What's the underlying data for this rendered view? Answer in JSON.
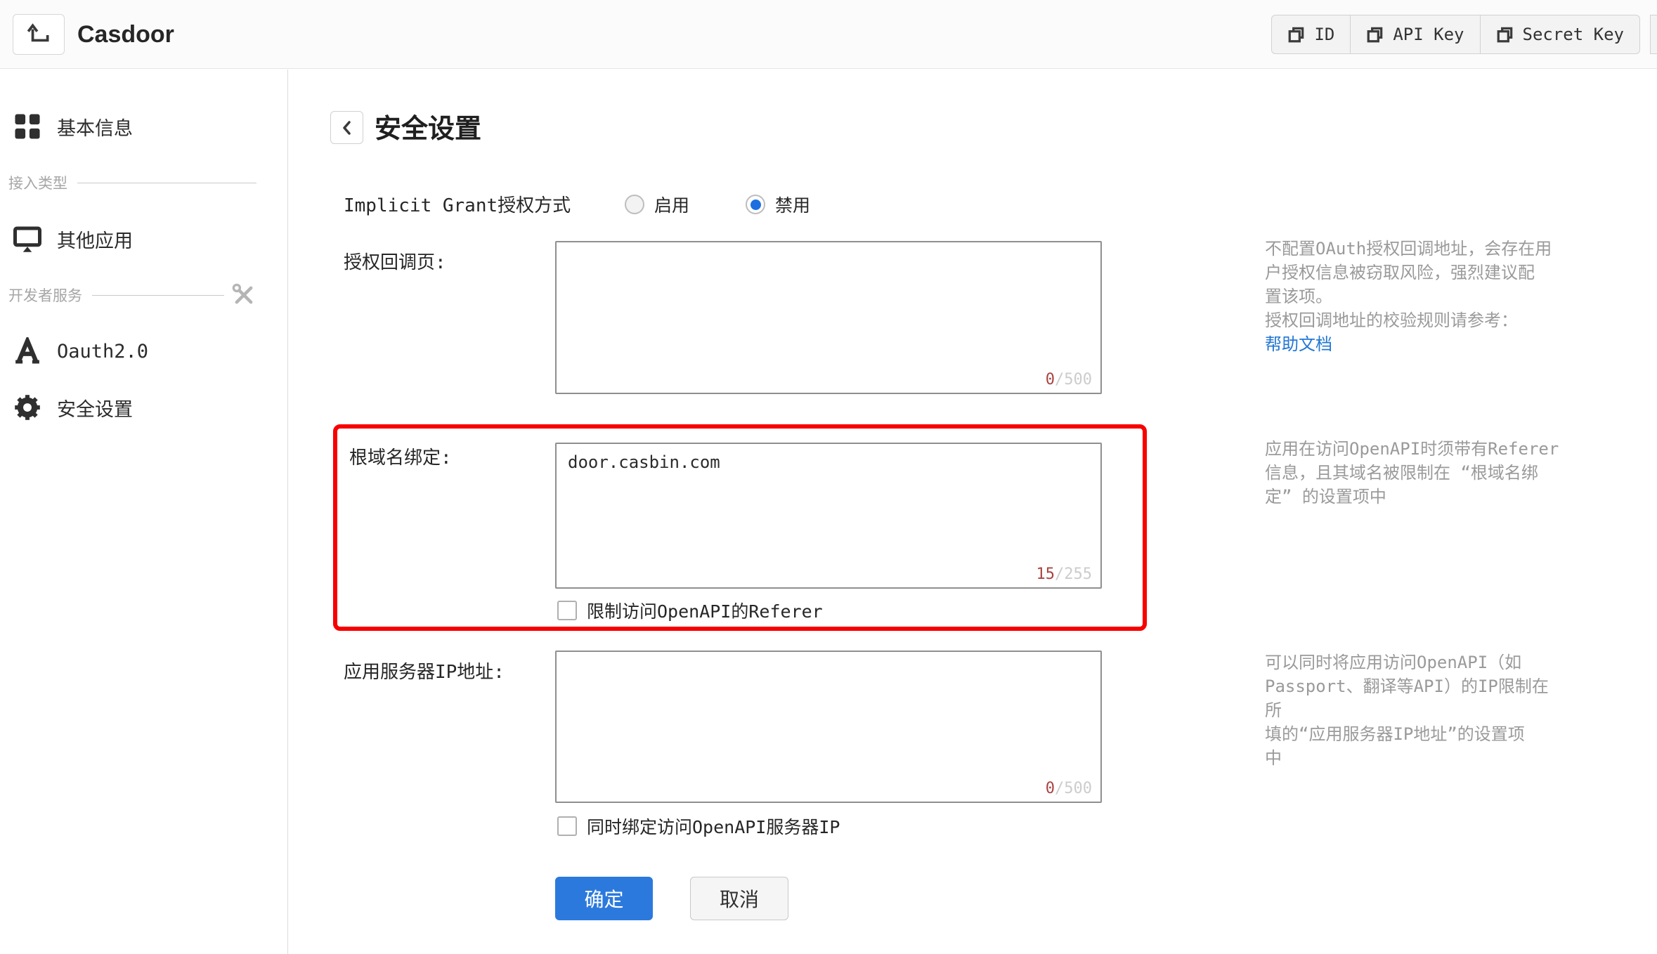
{
  "header": {
    "title": "Casdoor",
    "copy_group": [
      {
        "label": "ID"
      },
      {
        "label": "API Key"
      },
      {
        "label": "Secret Key"
      }
    ]
  },
  "sidebar": {
    "items": [
      {
        "label": "基本信息",
        "icon": "grid-icon"
      },
      {
        "label": "其他应用",
        "icon": "monitor-icon"
      },
      {
        "label": "Oauth2.0",
        "icon": "oauth-icon"
      },
      {
        "label": "安全设置",
        "icon": "gear-icon"
      }
    ],
    "sections": [
      {
        "label": "接入类型"
      },
      {
        "label": "开发者服务",
        "icon": "tools-icon"
      }
    ]
  },
  "page": {
    "title": "安全设置"
  },
  "form": {
    "implicit_grant": {
      "label": "Implicit Grant授权方式",
      "options": [
        {
          "label": "启用",
          "selected": false
        },
        {
          "label": "禁用",
          "selected": true
        }
      ]
    },
    "callback_urls": {
      "label": "授权回调页:",
      "value": "",
      "counter_used": "0",
      "counter_rest": "/500"
    },
    "root_domain": {
      "label": "根域名绑定:",
      "value": "door.casbin.com",
      "counter_used": "15",
      "counter_rest": "/255",
      "checkbox_label": "限制访问OpenAPI的Referer",
      "checked": false
    },
    "server_ip": {
      "label": "应用服务器IP地址:",
      "value": "",
      "counter_used": "0",
      "counter_rest": "/500",
      "checkbox_label": "同时绑定访问OpenAPI服务器IP",
      "checked": false
    },
    "submit_label": "确定",
    "cancel_label": "取消"
  },
  "help": [
    {
      "lines": [
        "不配置OAuth授权回调地址，会存在用",
        "户授权信息被窃取风险，强烈建议配",
        "置该项。",
        "授权回调地址的校验规则请参考："
      ],
      "link": "帮助文档"
    },
    {
      "lines": [
        "应用在访问OpenAPI时须带有Referer",
        "信息，且其域名被限制在 “根域名绑",
        "定” 的设置项中"
      ]
    },
    {
      "lines": [
        "可以同时将应用访问OpenAPI（如",
        "Passport、翻译等API）的IP限制在所",
        "填的“应用服务器IP地址”的设置项",
        "中"
      ]
    }
  ],
  "colors": {
    "accent_blue": "#2b79dd",
    "link_blue": "#2277d4",
    "counter_red": "#a94442",
    "highlight_red": "#f80000"
  }
}
